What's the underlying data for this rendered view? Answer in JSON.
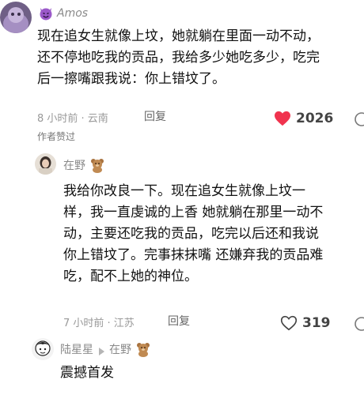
{
  "comment1": {
    "username": "Amos",
    "body_lines": [
      "现在追女生就像上坟，她就躺在里面一动不动，",
      "还不停地吃我的贡品，我给多少她吃多少，吃完",
      "后一擦嘴跟我说：你上错坟了。"
    ],
    "time_location": "8 小时前 · 云南",
    "reply_label": "回复",
    "like_count": "2026",
    "author_liked_label": "作者赞过",
    "colors": {
      "heart": "#f0334e"
    }
  },
  "comment2": {
    "username": "在野",
    "body_lines": [
      "我给你改良一下。现在追女生就像上坟一",
      "样，我一直虔诚的上香 她就躺在那里一动不",
      "动，主要还吃我的贡品，吃完以后还和我说",
      "你上错坟了。完事抹抹嘴 还嫌弃我的贡品难",
      "吃，配不上她的神位。"
    ],
    "time_location": "7 小时前 · 江苏",
    "reply_label": "回复",
    "like_count": "319"
  },
  "comment3": {
    "username": "陆星星",
    "reply_to": "在野",
    "body": "震撼首发"
  }
}
